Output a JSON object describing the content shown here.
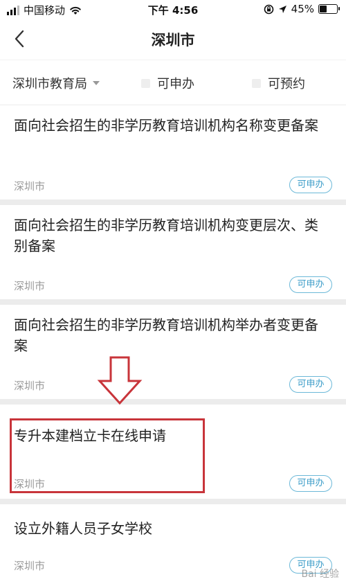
{
  "status_bar": {
    "carrier": "中国移动",
    "time": "下午 4:56",
    "battery": "45%",
    "battery_level": 0.45,
    "icons": [
      "signal-icon",
      "wifi-icon",
      "orientation-lock-icon",
      "location-icon",
      "battery-icon"
    ]
  },
  "nav": {
    "title": "深圳市",
    "back_icon": "chevron-left-icon"
  },
  "filters": {
    "department": "深圳市教育局",
    "option1": "可申办",
    "option2": "可预约"
  },
  "items": [
    {
      "title": "面向社会招生的非学历教育培训机构名称变更备案",
      "location": "深圳市",
      "badge": "可申办"
    },
    {
      "title": "面向社会招生的非学历教育培训机构变更层次、类别备案",
      "location": "深圳市",
      "badge": "可申办"
    },
    {
      "title": "面向社会招生的非学历教育培训机构举办者变更备案",
      "location": "深圳市",
      "badge": "可申办"
    },
    {
      "title": "专升本建档立卡在线申请",
      "location": "深圳市",
      "badge": "可申办"
    },
    {
      "title": "设立外籍人员子女学校",
      "location": "深圳市",
      "badge": "可申办"
    }
  ],
  "annotation": {
    "color": "#c8343a"
  },
  "colors": {
    "accent": "#3b9cc8",
    "badge_border": "#6bb8d8",
    "background": "#ececec"
  }
}
